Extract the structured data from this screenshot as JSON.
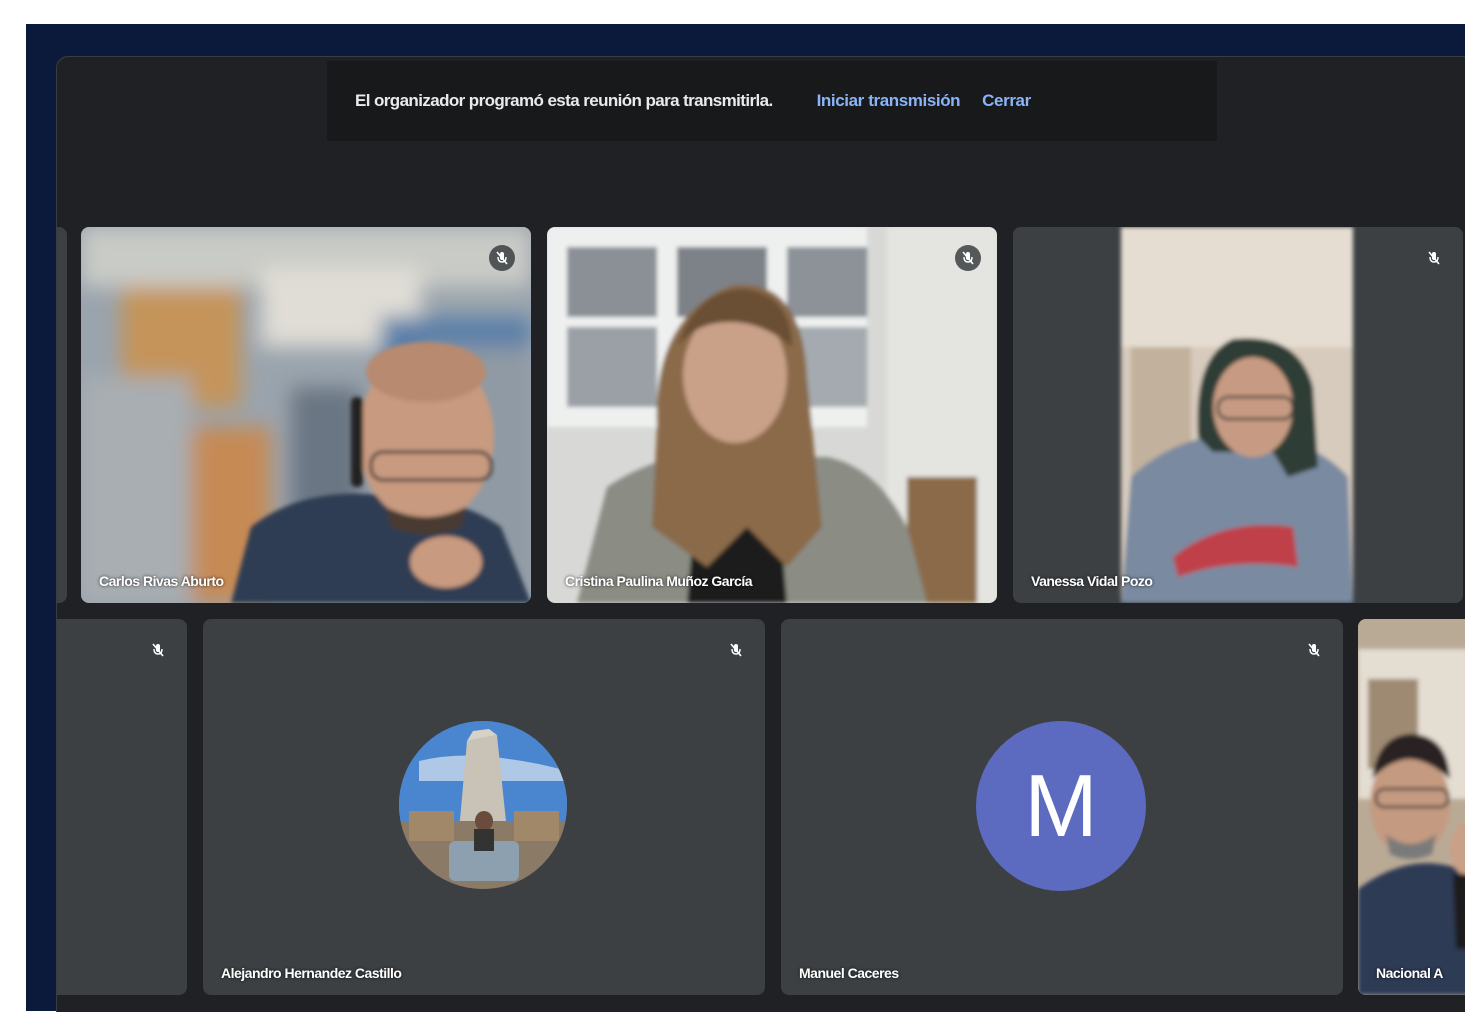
{
  "banner": {
    "message": "El organizador programó esta reunión para transmitirla.",
    "start_label": "Iniciar transmisión",
    "close_label": "Cerrar"
  },
  "participants": [
    {
      "name": "Carlos Rivas Aburto",
      "muted": true,
      "video": "on"
    },
    {
      "name": "Cristina Paulina Muñoz García",
      "muted": true,
      "video": "on"
    },
    {
      "name": "Vanessa Vidal Pozo",
      "muted": true,
      "video": "on"
    },
    {
      "name": "",
      "muted": true,
      "video": "off"
    },
    {
      "name": "Alejandro Hernandez Castillo",
      "muted": true,
      "video": "off",
      "avatar": "photo"
    },
    {
      "name": "Manuel Caceres",
      "muted": true,
      "video": "off",
      "avatar_letter": "M"
    },
    {
      "name": "Nacional A",
      "muted": false,
      "video": "on",
      "selected": true
    }
  ],
  "colors": {
    "background": "#202124",
    "tile": "#3c4043",
    "accent_link": "#8ab4f8",
    "avatar_letter_bg": "#5c6bc0",
    "frame": "#0b1a3a"
  }
}
